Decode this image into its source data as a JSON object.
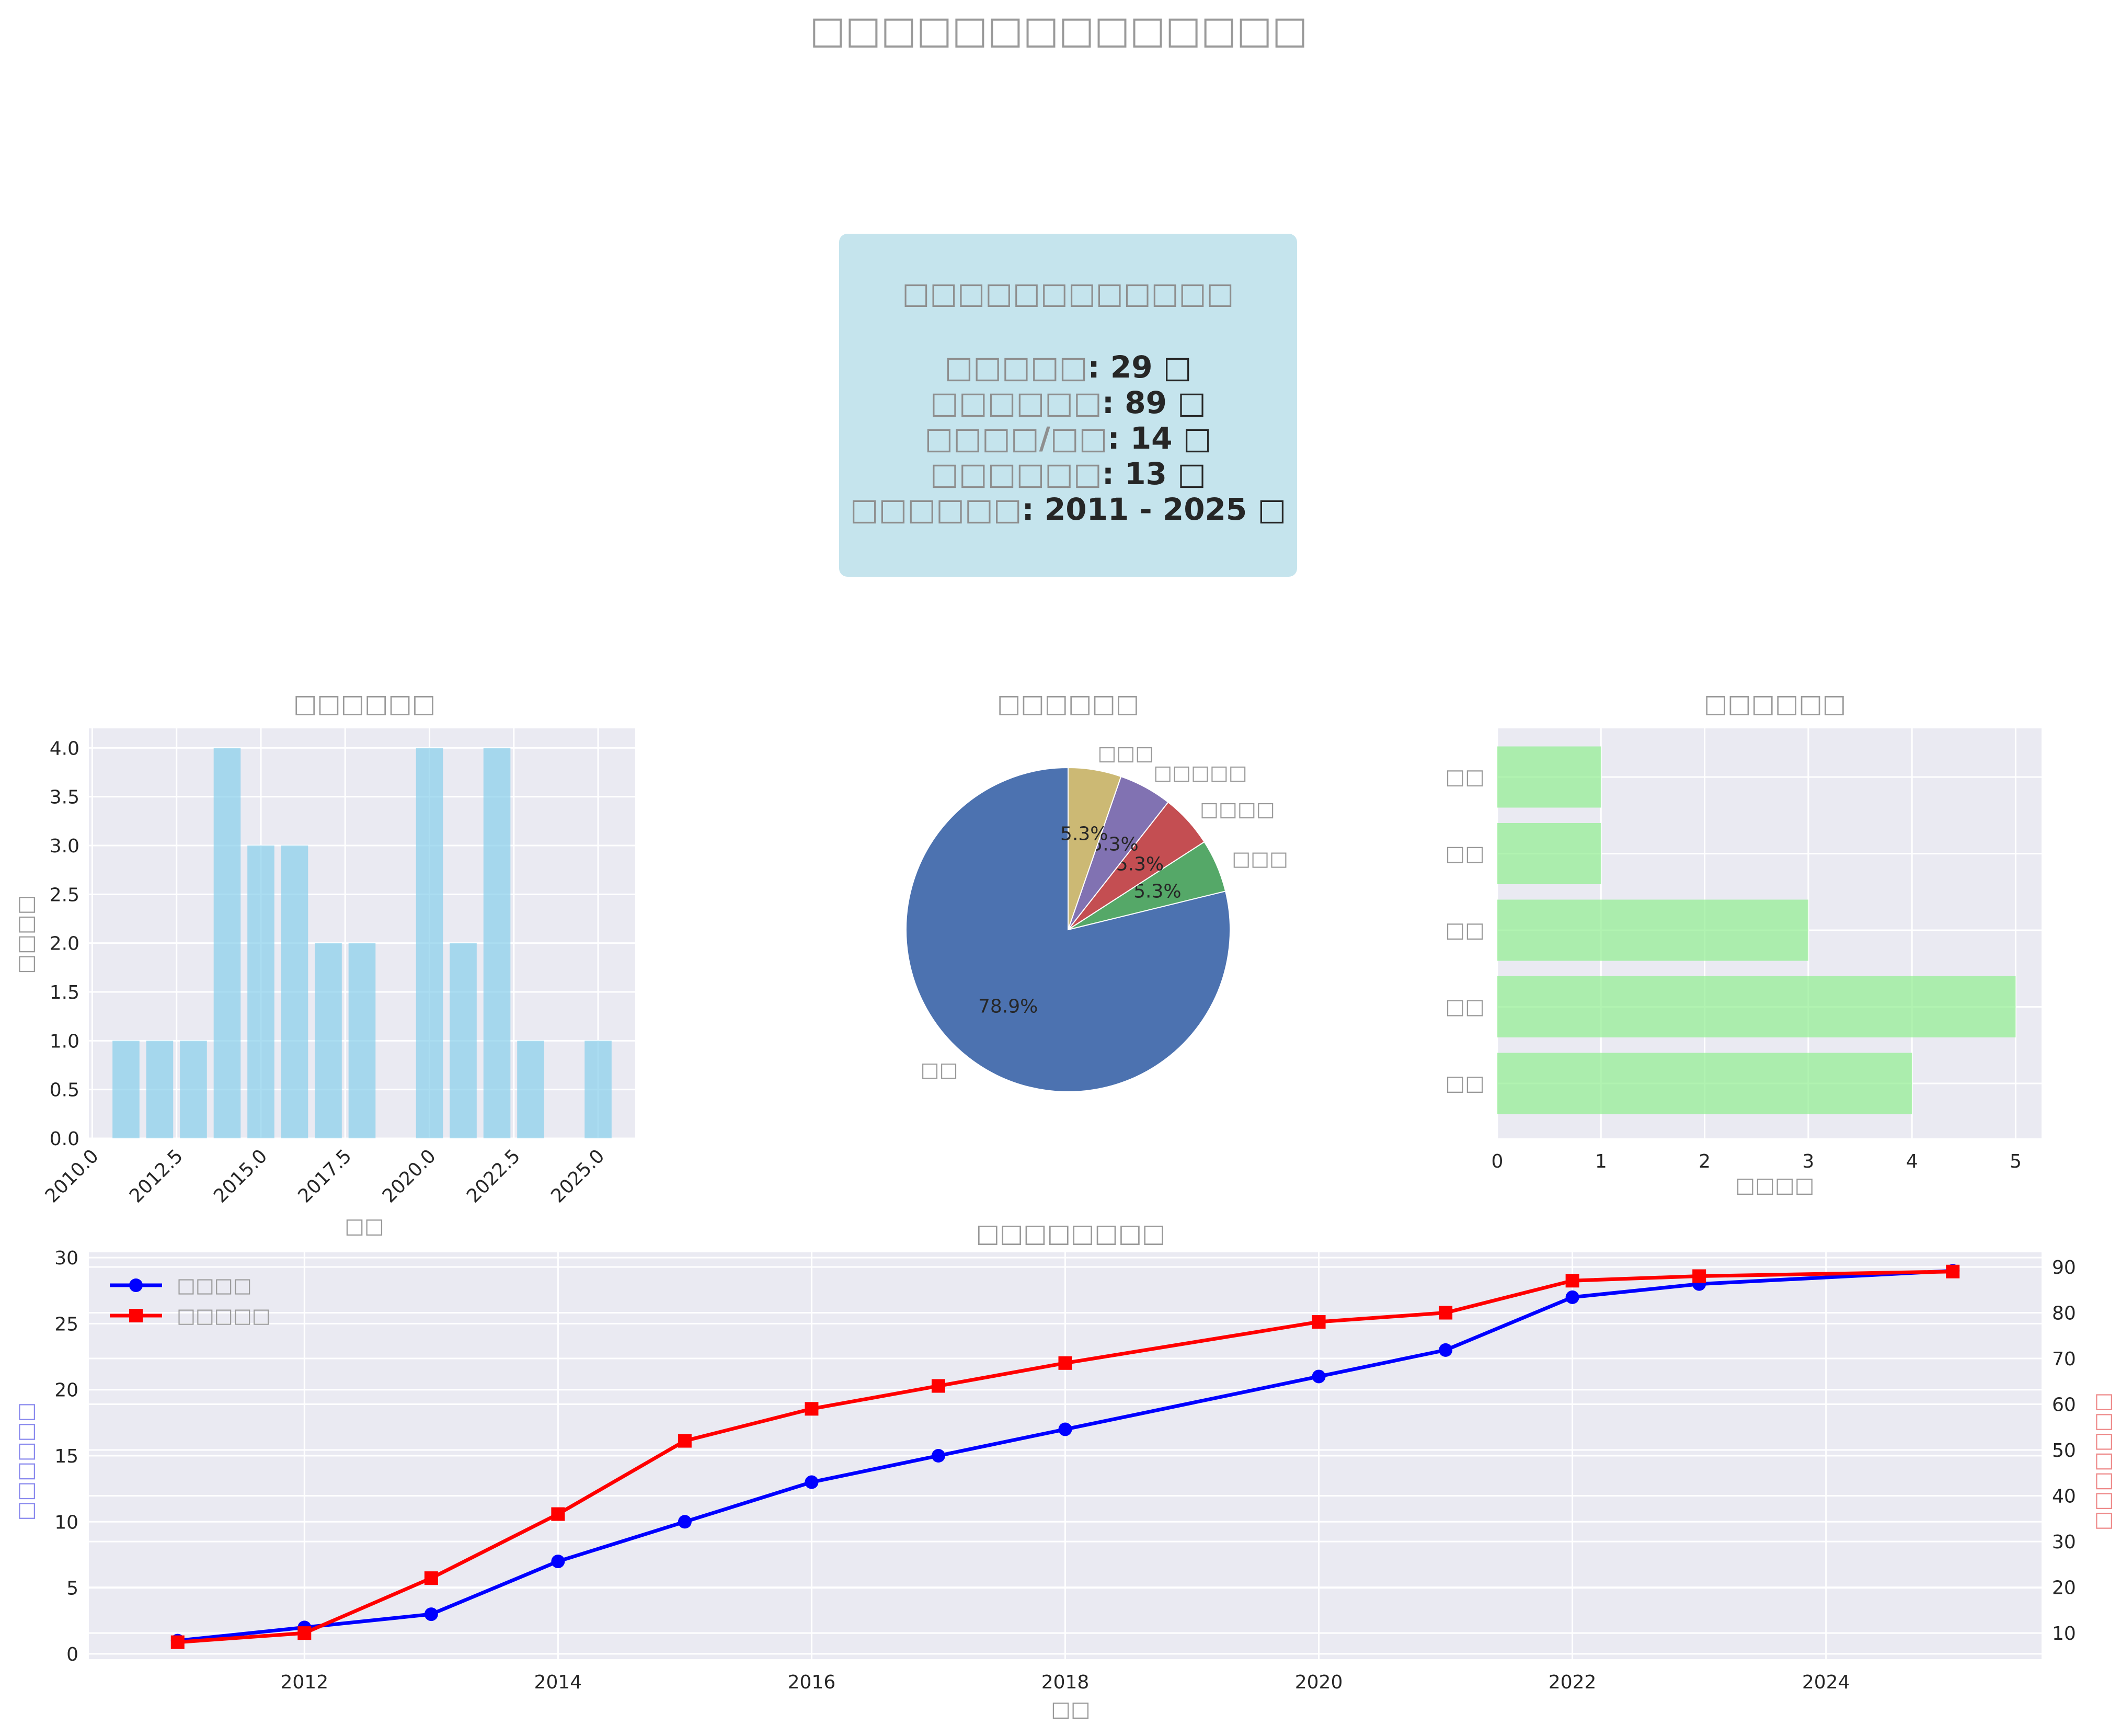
{
  "figure": {
    "suptitle": "□□□□□□□□□□□□□□",
    "summary": {
      "title": "□□□□□□□□□□□□",
      "lines": [
        {
          "label": "□□□□□",
          "value": ": 29 □"
        },
        {
          "label": "□□□□□□",
          "value": ": 89 □"
        },
        {
          "label": "□□□□/□□",
          "value": ": 14 □"
        },
        {
          "label": "□□□□□□",
          "value": ": 13 □"
        },
        {
          "label": "□□□□□□",
          "value": ": 2011 - 2025 □"
        }
      ]
    }
  },
  "chart_data": [
    {
      "type": "bar",
      "title": "□□□□□□",
      "xlabel": "□□",
      "ylabel": "□□□□",
      "x": [
        2011,
        2012,
        2013,
        2014,
        2015,
        2016,
        2017,
        2018,
        2020,
        2021,
        2022,
        2023,
        2025
      ],
      "values": [
        1,
        1,
        1,
        4,
        3,
        3,
        2,
        2,
        4,
        2,
        4,
        1,
        1
      ],
      "xticks": [
        "2010.0",
        "2012.5",
        "2015.0",
        "2017.5",
        "2020.0",
        "2022.5",
        "2025.0"
      ],
      "yticks": [
        "0.0",
        "0.5",
        "1.0",
        "1.5",
        "2.0",
        "2.5",
        "3.0",
        "3.5",
        "4.0"
      ],
      "xlim": [
        2009.9,
        2026.1
      ],
      "ylim": [
        0,
        4.2
      ],
      "color": "#87ceeb",
      "grid": true
    },
    {
      "type": "pie",
      "title": "□□□□□□",
      "labels": [
        "□□",
        "□□□",
        "□□□□",
        "□□□□□",
        "□□□"
      ],
      "values": [
        78.9,
        5.3,
        5.3,
        5.3,
        5.3
      ],
      "autopct": [
        "78.9%",
        "5.3%",
        "5.3%",
        "5.3%",
        "5.3%"
      ],
      "colors": [
        "#4c72b0",
        "#55a868",
        "#c44e52",
        "#8172b2",
        "#ccb974"
      ]
    },
    {
      "type": "bar",
      "orientation": "horizontal",
      "title": "□□□□□□",
      "xlabel": "□□□□",
      "categories": [
        "□□",
        "□□",
        "□□",
        "□□",
        "□□"
      ],
      "values": [
        4,
        5,
        3,
        1,
        1
      ],
      "xticks": [
        "0",
        "1",
        "2",
        "3",
        "4",
        "5"
      ],
      "xlim": [
        0,
        5.25
      ],
      "color": "#90ee90",
      "grid": true
    },
    {
      "type": "line",
      "title": "□□□□□□□□",
      "xlabel": "□□",
      "ylabel": "□□□□□□",
      "ylabel_right": "□□□□□□□",
      "legend_position": "top-left",
      "x": [
        2011,
        2012,
        2013,
        2014,
        2015,
        2016,
        2017,
        2018,
        2020,
        2021,
        2022,
        2023,
        2025
      ],
      "xticks": [
        "2012",
        "2014",
        "2016",
        "2018",
        "2020",
        "2022",
        "2024"
      ],
      "xlim": [
        2010.3,
        2025.7
      ],
      "series": [
        {
          "name": "□□□□",
          "axis": "left",
          "color": "#0000ff",
          "marker": "circle",
          "values": [
            1,
            2,
            3,
            7,
            10,
            13,
            15,
            17,
            21,
            23,
            27,
            28,
            29
          ]
        },
        {
          "name": "□□□□□",
          "axis": "right",
          "color": "#ff0000",
          "marker": "square",
          "values": [
            8,
            10,
            22,
            36,
            52,
            59,
            64,
            69,
            78,
            80,
            87,
            88,
            89
          ]
        }
      ],
      "yticks_left": [
        "0",
        "5",
        "10",
        "15",
        "20",
        "25",
        "30"
      ],
      "yticks_right": [
        "10",
        "20",
        "30",
        "40",
        "50",
        "60",
        "70",
        "80",
        "90"
      ],
      "ylim_left": [
        -0.4,
        30.4
      ],
      "ylim_right": [
        4.3,
        93.2
      ],
      "grid": true
    }
  ]
}
